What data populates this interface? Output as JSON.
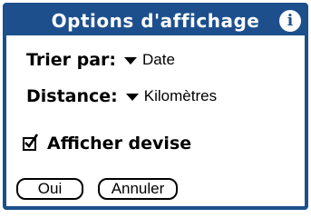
{
  "dialog": {
    "title": "Options d'affichage",
    "info_icon": "info-icon",
    "info_glyph": "i",
    "accent_color": "#1d4f8c"
  },
  "sort": {
    "label": "Trier par:",
    "value": "Date"
  },
  "distance": {
    "label": "Distance:",
    "value": "Kilomètres"
  },
  "show_currency": {
    "label": "Afficher devise",
    "checked": true
  },
  "buttons": {
    "ok": "Oui",
    "cancel": "Annuler"
  }
}
